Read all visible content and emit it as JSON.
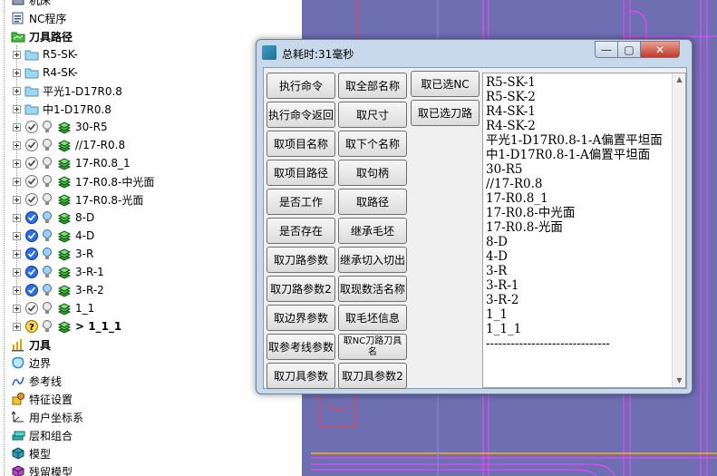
{
  "tree": {
    "items": [
      {
        "label": "机床",
        "icon": "machine-icon",
        "level": 0
      },
      {
        "label": "NC程序",
        "icon": "nc-program-icon",
        "level": 0
      },
      {
        "label": "刀具路径",
        "icon": "toolpath-folder-icon",
        "level": 0,
        "bold": true
      },
      {
        "label": "R5-SK-",
        "icon": "folder-icon",
        "level": 1
      },
      {
        "label": "R4-SK-",
        "icon": "folder-icon",
        "level": 1
      },
      {
        "label": "平光1-D17R0.8",
        "icon": "folder-icon",
        "level": 1
      },
      {
        "label": "中1-D17R0.8",
        "icon": "folder-icon",
        "level": 1
      },
      {
        "label": "30-R5",
        "icon": "toolpath-icon",
        "level": 1
      },
      {
        "label": "//17-R0.8",
        "icon": "toolpath-icon",
        "level": 1
      },
      {
        "label": "17-R0.8_1",
        "icon": "toolpath-icon",
        "level": 1
      },
      {
        "label": "17-R0.8-中光面",
        "icon": "toolpath-icon",
        "level": 1
      },
      {
        "label": "17-R0.8-光面",
        "icon": "toolpath-icon",
        "level": 1
      },
      {
        "label": "8-D",
        "icon": "toolpath-icon",
        "level": 1
      },
      {
        "label": "4-D",
        "icon": "toolpath-icon",
        "level": 1
      },
      {
        "label": "3-R",
        "icon": "toolpath-icon",
        "level": 1
      },
      {
        "label": "3-R-1",
        "icon": "toolpath-icon",
        "level": 1
      },
      {
        "label": "3-R-2",
        "icon": "toolpath-icon",
        "level": 1
      },
      {
        "label": "1_1",
        "icon": "toolpath-icon",
        "level": 1
      },
      {
        "label": "> 1_1_1",
        "icon": "toolpath-icon",
        "level": 1,
        "bold": true
      },
      {
        "label": "刀具",
        "icon": "tool-icon",
        "level": 0,
        "bold": true
      },
      {
        "label": "边界",
        "icon": "boundary-icon",
        "level": 0
      },
      {
        "label": "参考线",
        "icon": "pattern-icon",
        "level": 0
      },
      {
        "label": "特征设置",
        "icon": "feature-icon",
        "level": 0
      },
      {
        "label": "用户坐标系",
        "icon": "workplane-icon",
        "level": 0
      },
      {
        "label": "层和组合",
        "icon": "layer-icon",
        "level": 0
      },
      {
        "label": "模型",
        "icon": "model-icon",
        "level": 0
      },
      {
        "label": "残留模型",
        "icon": "stock-model-icon",
        "level": 0
      }
    ]
  },
  "dialog": {
    "title": "总耗时:31毫秒",
    "min_glyph": "—",
    "max_glyph": "▢",
    "close_glyph": "✕",
    "buttons_col1": [
      "执行命令",
      "执行命令返回",
      "取项目名称",
      "取项目路径",
      "是否工作",
      "是否存在",
      "取刀路参数",
      "取刀路参数2",
      "取边界参数",
      "取参考线参数",
      "取刀具参数"
    ],
    "buttons_col2": [
      "取全部名称",
      "取尺寸",
      "取下个名称",
      "取句柄",
      "取路径",
      "继承毛坯",
      "继承切入切出",
      "取现数活名称",
      "取毛坯信息",
      "取NC刀路刀具名",
      "取刀具参数2"
    ],
    "buttons_col3": [
      "取已选NC",
      "取已选刀路"
    ],
    "output_lines": [
      "R5-SK-1",
      "R5-SK-2",
      "R4-SK-1",
      "R4-SK-2",
      "平光1-D17R0.8-1-A偏置平坦面",
      "中1-D17R0.8-1-A偏置平坦面",
      "30-R5",
      "//17-R0.8",
      "17-R0.8_1",
      "17-R0.8-中光面",
      "17-R0.8-光面",
      "8-D",
      "4-D",
      "3-R",
      "3-R-1",
      "3-R-2",
      "1_1",
      "1_1_1",
      "------------------------------"
    ]
  },
  "colors": {
    "canvas_bg": "#6e6eb3",
    "toolpath_magenta": "#ff00ff",
    "boundary_red": "#ff2a2a",
    "dialog_frame": "#c9d9ec"
  }
}
